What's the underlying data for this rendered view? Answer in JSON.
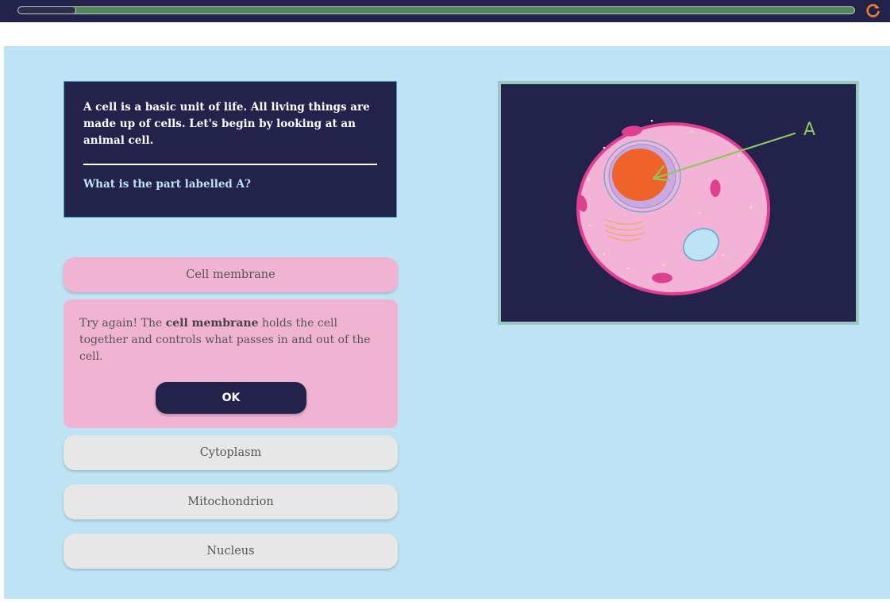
{
  "header": {
    "progress": 0.068,
    "refresh_icon": "refresh-icon",
    "accent_color": "#f07a30"
  },
  "question": {
    "intro": "A cell is a basic unit of life. All living things are made up of cells. Let's begin by looking at an animal cell.",
    "prompt": "What is the part labelled A?"
  },
  "options": [
    {
      "label": "Cell membrane",
      "selected": true
    },
    {
      "label": "Cytoplasm",
      "selected": false
    },
    {
      "label": "Mitochondrion",
      "selected": false
    },
    {
      "label": "Nucleus",
      "selected": false
    }
  ],
  "feedback": {
    "prefix": "Try again! The ",
    "term": "cell membrane",
    "suffix": " holds the cell together and controls what passes in and out of the cell.",
    "ok_label": "OK"
  },
  "diagram": {
    "label": "A"
  },
  "colors": {
    "dark_navy": "#22224a",
    "panel_blue": "#bde3f5",
    "selected_pink": "#f0b3d2",
    "option_gray": "#e7e7e7",
    "progress_green": "#4e8a55",
    "label_green": "#8fc65d"
  }
}
